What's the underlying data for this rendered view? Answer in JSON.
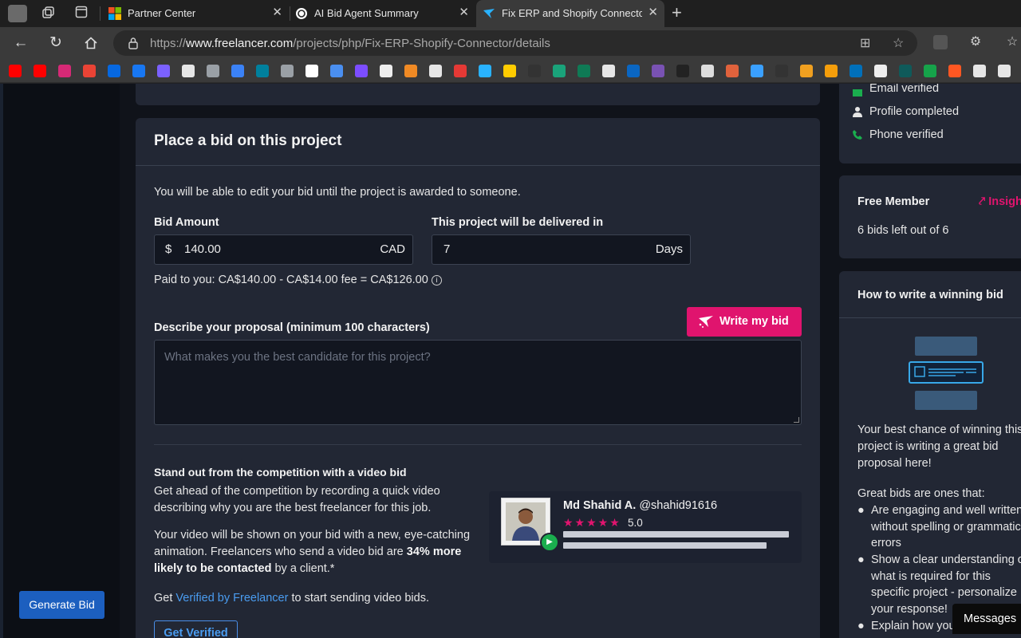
{
  "browser": {
    "tabs": [
      {
        "label": "Partner Center",
        "icon": "microsoft-icon"
      },
      {
        "label": "AI Bid Agent Summary",
        "icon": "openai-icon"
      },
      {
        "label": "Fix ERP and Shopify Connector Sy",
        "icon": "freelancer-icon",
        "active": true
      }
    ],
    "url_scheme": "https://",
    "url_host": "www.freelancer.com",
    "url_path": "/projects/php/Fix-ERP-Shopify-Connector/details"
  },
  "bookmarks": [
    "youtube",
    "youtube",
    "instagram",
    "gmail",
    "meta",
    "facebook",
    "link",
    "openai",
    "image",
    "store",
    "bing",
    "image",
    "google",
    "gemini",
    "list",
    "notion",
    "canva",
    "diamond",
    "300",
    "freelancer",
    "arrow",
    "dark",
    "xl",
    "c",
    "github",
    "linkedin",
    "bootstrap",
    "unsplash",
    "keyboard",
    "hat",
    "circle",
    "dark",
    "infinity",
    "layers",
    "paypal",
    "tool",
    "t",
    "leaf",
    "coffee",
    "a",
    "fx"
  ],
  "sidebar": {
    "generate_label": "Generate Bid"
  },
  "bid": {
    "title": "Place a bid on this project",
    "edit_note": "You will be able to edit your bid until the project is awarded to someone.",
    "amount_label": "Bid Amount",
    "currency_symbol": "$",
    "amount_value": "140.00",
    "currency_code": "CAD",
    "delivery_label": "This project will be delivered in",
    "delivery_value": "7",
    "delivery_unit": "Days",
    "paid_text": "Paid to you: CA$140.00 - CA$14.00 fee = CA$126.00",
    "proposal_label": "Describe your proposal (minimum 100 characters)",
    "write_button": "Write my bid",
    "proposal_placeholder": "What makes you the best candidate for this project?"
  },
  "video": {
    "heading": "Stand out from the competition with a video bid",
    "p1": "Get ahead of the competition by recording a quick video describing why you are the best freelancer for this job.",
    "p2_a": "Your video will be shown on your bid with a new, eye-catching animation. Freelancers who send a video bid are ",
    "p2_b": "34% more likely to be contacted",
    "p2_c": " by a client.*",
    "p3_a": "Get ",
    "p3_link": "Verified by Freelancer",
    "p3_b": " to start sending video bids.",
    "button": "Get Verified",
    "sample_name": "Md Shahid A.",
    "sample_handle": "@shahid91616",
    "sample_rating": "5.0",
    "sample_stars": 5
  },
  "right": {
    "verifications": [
      "Email verified",
      "Profile completed",
      "Phone verified"
    ],
    "member_title": "Free Member",
    "insights": "Insights",
    "bids_left": "6 bids left out of 6",
    "howto_title": "How to write a winning bid",
    "howto_intro": [
      "Your best chance of winning this",
      "project is writing a great bid",
      "proposal here!"
    ],
    "great_bids": "Great bids are ones that:",
    "bullets": [
      [
        "Are engaging and well written",
        "without spelling or grammatical",
        "errors"
      ],
      [
        "Show a clear understanding of",
        "what is required for this",
        "specific project - personalize",
        "your response!"
      ],
      [
        "Explain how you"
      ]
    ]
  },
  "messages_label": "Messages",
  "colors": {
    "accent": "#e0146e",
    "primary": "#1c5fbf",
    "link": "#4a9cf0",
    "card": "#222734",
    "background": "#10131a"
  }
}
